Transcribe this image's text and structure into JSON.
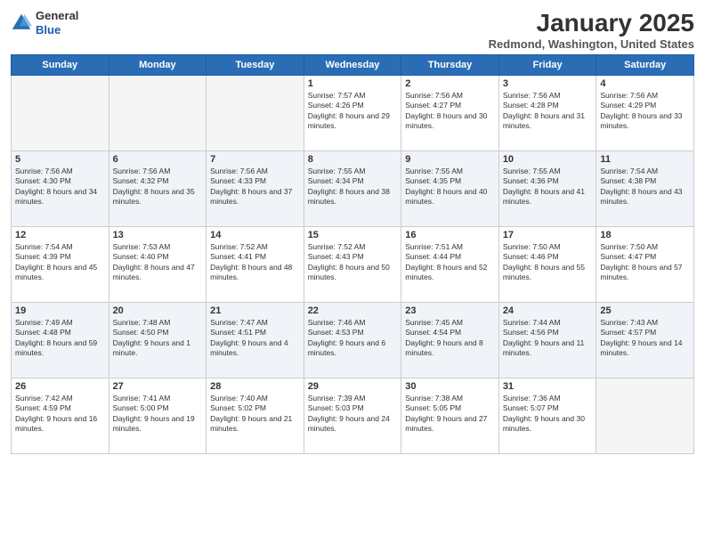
{
  "header": {
    "logo_general": "General",
    "logo_blue": "Blue",
    "month_title": "January 2025",
    "location": "Redmond, Washington, United States"
  },
  "weekdays": [
    "Sunday",
    "Monday",
    "Tuesday",
    "Wednesday",
    "Thursday",
    "Friday",
    "Saturday"
  ],
  "weeks": [
    [
      {
        "day": "",
        "empty": true
      },
      {
        "day": "",
        "empty": true
      },
      {
        "day": "",
        "empty": true
      },
      {
        "day": "1",
        "sunrise": "7:57 AM",
        "sunset": "4:26 PM",
        "daylight": "8 hours and 29 minutes."
      },
      {
        "day": "2",
        "sunrise": "7:56 AM",
        "sunset": "4:27 PM",
        "daylight": "8 hours and 30 minutes."
      },
      {
        "day": "3",
        "sunrise": "7:56 AM",
        "sunset": "4:28 PM",
        "daylight": "8 hours and 31 minutes."
      },
      {
        "day": "4",
        "sunrise": "7:56 AM",
        "sunset": "4:29 PM",
        "daylight": "8 hours and 33 minutes."
      }
    ],
    [
      {
        "day": "5",
        "sunrise": "7:56 AM",
        "sunset": "4:30 PM",
        "daylight": "8 hours and 34 minutes."
      },
      {
        "day": "6",
        "sunrise": "7:56 AM",
        "sunset": "4:32 PM",
        "daylight": "8 hours and 35 minutes."
      },
      {
        "day": "7",
        "sunrise": "7:56 AM",
        "sunset": "4:33 PM",
        "daylight": "8 hours and 37 minutes."
      },
      {
        "day": "8",
        "sunrise": "7:55 AM",
        "sunset": "4:34 PM",
        "daylight": "8 hours and 38 minutes."
      },
      {
        "day": "9",
        "sunrise": "7:55 AM",
        "sunset": "4:35 PM",
        "daylight": "8 hours and 40 minutes."
      },
      {
        "day": "10",
        "sunrise": "7:55 AM",
        "sunset": "4:36 PM",
        "daylight": "8 hours and 41 minutes."
      },
      {
        "day": "11",
        "sunrise": "7:54 AM",
        "sunset": "4:38 PM",
        "daylight": "8 hours and 43 minutes."
      }
    ],
    [
      {
        "day": "12",
        "sunrise": "7:54 AM",
        "sunset": "4:39 PM",
        "daylight": "8 hours and 45 minutes."
      },
      {
        "day": "13",
        "sunrise": "7:53 AM",
        "sunset": "4:40 PM",
        "daylight": "8 hours and 47 minutes."
      },
      {
        "day": "14",
        "sunrise": "7:52 AM",
        "sunset": "4:41 PM",
        "daylight": "8 hours and 48 minutes."
      },
      {
        "day": "15",
        "sunrise": "7:52 AM",
        "sunset": "4:43 PM",
        "daylight": "8 hours and 50 minutes."
      },
      {
        "day": "16",
        "sunrise": "7:51 AM",
        "sunset": "4:44 PM",
        "daylight": "8 hours and 52 minutes."
      },
      {
        "day": "17",
        "sunrise": "7:50 AM",
        "sunset": "4:46 PM",
        "daylight": "8 hours and 55 minutes."
      },
      {
        "day": "18",
        "sunrise": "7:50 AM",
        "sunset": "4:47 PM",
        "daylight": "8 hours and 57 minutes."
      }
    ],
    [
      {
        "day": "19",
        "sunrise": "7:49 AM",
        "sunset": "4:48 PM",
        "daylight": "8 hours and 59 minutes."
      },
      {
        "day": "20",
        "sunrise": "7:48 AM",
        "sunset": "4:50 PM",
        "daylight": "9 hours and 1 minute."
      },
      {
        "day": "21",
        "sunrise": "7:47 AM",
        "sunset": "4:51 PM",
        "daylight": "9 hours and 4 minutes."
      },
      {
        "day": "22",
        "sunrise": "7:46 AM",
        "sunset": "4:53 PM",
        "daylight": "9 hours and 6 minutes."
      },
      {
        "day": "23",
        "sunrise": "7:45 AM",
        "sunset": "4:54 PM",
        "daylight": "9 hours and 8 minutes."
      },
      {
        "day": "24",
        "sunrise": "7:44 AM",
        "sunset": "4:56 PM",
        "daylight": "9 hours and 11 minutes."
      },
      {
        "day": "25",
        "sunrise": "7:43 AM",
        "sunset": "4:57 PM",
        "daylight": "9 hours and 14 minutes."
      }
    ],
    [
      {
        "day": "26",
        "sunrise": "7:42 AM",
        "sunset": "4:59 PM",
        "daylight": "9 hours and 16 minutes."
      },
      {
        "day": "27",
        "sunrise": "7:41 AM",
        "sunset": "5:00 PM",
        "daylight": "9 hours and 19 minutes."
      },
      {
        "day": "28",
        "sunrise": "7:40 AM",
        "sunset": "5:02 PM",
        "daylight": "9 hours and 21 minutes."
      },
      {
        "day": "29",
        "sunrise": "7:39 AM",
        "sunset": "5:03 PM",
        "daylight": "9 hours and 24 minutes."
      },
      {
        "day": "30",
        "sunrise": "7:38 AM",
        "sunset": "5:05 PM",
        "daylight": "9 hours and 27 minutes."
      },
      {
        "day": "31",
        "sunrise": "7:36 AM",
        "sunset": "5:07 PM",
        "daylight": "9 hours and 30 minutes."
      },
      {
        "day": "",
        "empty": true
      }
    ]
  ]
}
